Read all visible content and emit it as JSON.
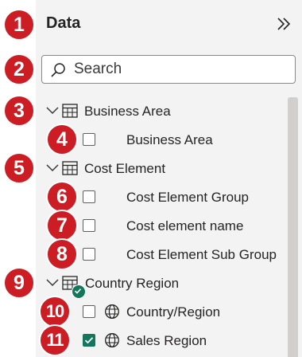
{
  "pane": {
    "title": "Data"
  },
  "search": {
    "placeholder": "Search"
  },
  "tables": [
    {
      "name": "Business Area",
      "fields": [
        {
          "label": "Business Area",
          "checked": false,
          "icon": "none"
        }
      ]
    },
    {
      "name": "Cost Element",
      "fields": [
        {
          "label": "Cost Element Group",
          "checked": false,
          "icon": "none"
        },
        {
          "label": "Cost element name",
          "checked": false,
          "icon": "none"
        },
        {
          "label": "Cost Element Sub Group",
          "checked": false,
          "icon": "none"
        }
      ]
    },
    {
      "name": "Country Region",
      "has_selection": true,
      "fields": [
        {
          "label": "Country/Region",
          "checked": false,
          "icon": "globe-icon"
        },
        {
          "label": "Sales Region",
          "checked": true,
          "icon": "globe-icon"
        }
      ]
    }
  ],
  "badges": [
    "1",
    "2",
    "3",
    "4",
    "5",
    "6",
    "7",
    "8",
    "9",
    "10",
    "11"
  ],
  "colors": {
    "badge": "#cc1c24",
    "accent": "#14775c",
    "pane_bg": "#f3f3f3"
  }
}
